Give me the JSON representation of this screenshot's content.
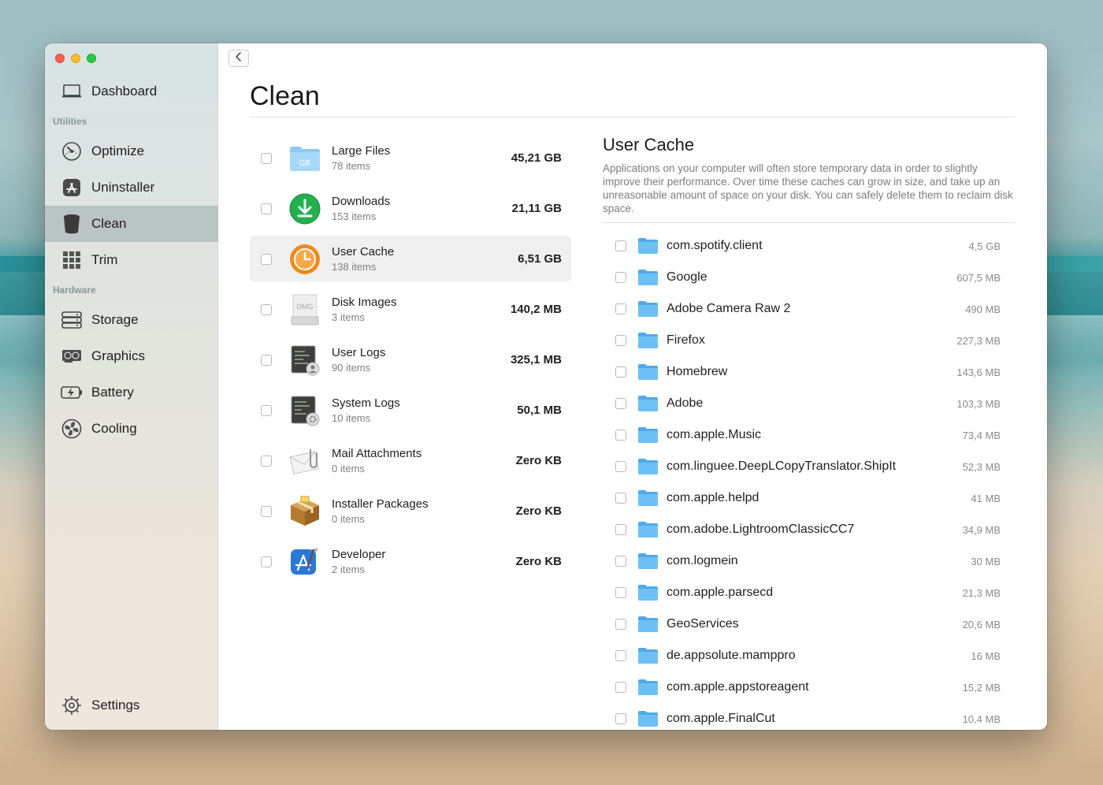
{
  "sidebar": {
    "items": [
      {
        "label": "Dashboard",
        "icon": "laptop-icon"
      },
      {
        "label": "Optimize",
        "icon": "gauge-icon"
      },
      {
        "label": "Uninstaller",
        "icon": "app-store-icon"
      },
      {
        "label": "Clean",
        "icon": "trash-can-icon"
      },
      {
        "label": "Trim",
        "icon": "grid-icon"
      },
      {
        "label": "Storage",
        "icon": "drive-icon"
      },
      {
        "label": "Graphics",
        "icon": "gpu-icon"
      },
      {
        "label": "Battery",
        "icon": "battery-icon"
      },
      {
        "label": "Cooling",
        "icon": "fan-icon"
      },
      {
        "label": "Settings",
        "icon": "gear-icon"
      }
    ],
    "section_utilities": "Utilities",
    "section_hardware": "Hardware",
    "active_item": "Clean"
  },
  "main": {
    "title": "Clean",
    "categories": [
      {
        "name": "Large Files",
        "count": "78 items",
        "size": "45,21 GB",
        "icon": "large-files-folder-icon"
      },
      {
        "name": "Downloads",
        "count": "153 items",
        "size": "21,11 GB",
        "icon": "downloads-icon"
      },
      {
        "name": "User Cache",
        "count": "138 items",
        "size": "6,51 GB",
        "icon": "clock-icon"
      },
      {
        "name": "Disk Images",
        "count": "3 items",
        "size": "140,2 MB",
        "icon": "dmg-icon"
      },
      {
        "name": "User Logs",
        "count": "90 items",
        "size": "325,1 MB",
        "icon": "user-log-icon"
      },
      {
        "name": "System Logs",
        "count": "10 items",
        "size": "50,1 MB",
        "icon": "system-log-icon"
      },
      {
        "name": "Mail Attachments",
        "count": "0 items",
        "size": "Zero KB",
        "icon": "mail-attachment-icon"
      },
      {
        "name": "Installer Packages",
        "count": "0 items",
        "size": "Zero KB",
        "icon": "package-icon"
      },
      {
        "name": "Developer",
        "count": "2 items",
        "size": "Zero KB",
        "icon": "xcode-icon"
      }
    ],
    "selected_category": "User Cache",
    "large_files_icon_text": "GB",
    "disk_images_icon_text": "DMG"
  },
  "detail": {
    "title": "User Cache",
    "description": "Applications on your computer will often store temporary data in order to slightly improve their performance. Over time these caches can grow in size, and take up an unreasonable amount of space on your disk. You can safely delete them to reclaim disk space.",
    "files": [
      {
        "name": "com.spotify.client",
        "size": "4,5 GB"
      },
      {
        "name": "Google",
        "size": "607,5 MB"
      },
      {
        "name": "Adobe Camera Raw 2",
        "size": "490 MB"
      },
      {
        "name": "Firefox",
        "size": "227,3 MB"
      },
      {
        "name": "Homebrew",
        "size": "143,6 MB"
      },
      {
        "name": "Adobe",
        "size": "103,3 MB"
      },
      {
        "name": "com.apple.Music",
        "size": "73,4 MB"
      },
      {
        "name": "com.linguee.DeepLCopyTranslator.ShipIt",
        "size": "52,3 MB"
      },
      {
        "name": "com.apple.helpd",
        "size": "41 MB"
      },
      {
        "name": "com.adobe.LightroomClassicCC7",
        "size": "34,9 MB"
      },
      {
        "name": "com.logmein",
        "size": "30 MB"
      },
      {
        "name": "com.apple.parsecd",
        "size": "21,3 MB"
      },
      {
        "name": "GeoServices",
        "size": "20,6 MB"
      },
      {
        "name": "de.appsolute.mamppro",
        "size": "16 MB"
      },
      {
        "name": "com.apple.appstoreagent",
        "size": "15,2 MB"
      },
      {
        "name": "com.apple.FinalCut",
        "size": "10,4 MB"
      }
    ]
  },
  "colors": {
    "folder": "#5fb6f0",
    "downloads_green": "#22b14c",
    "cache_orange": "#f08a1d",
    "selected_row": "#f0f0f0"
  }
}
